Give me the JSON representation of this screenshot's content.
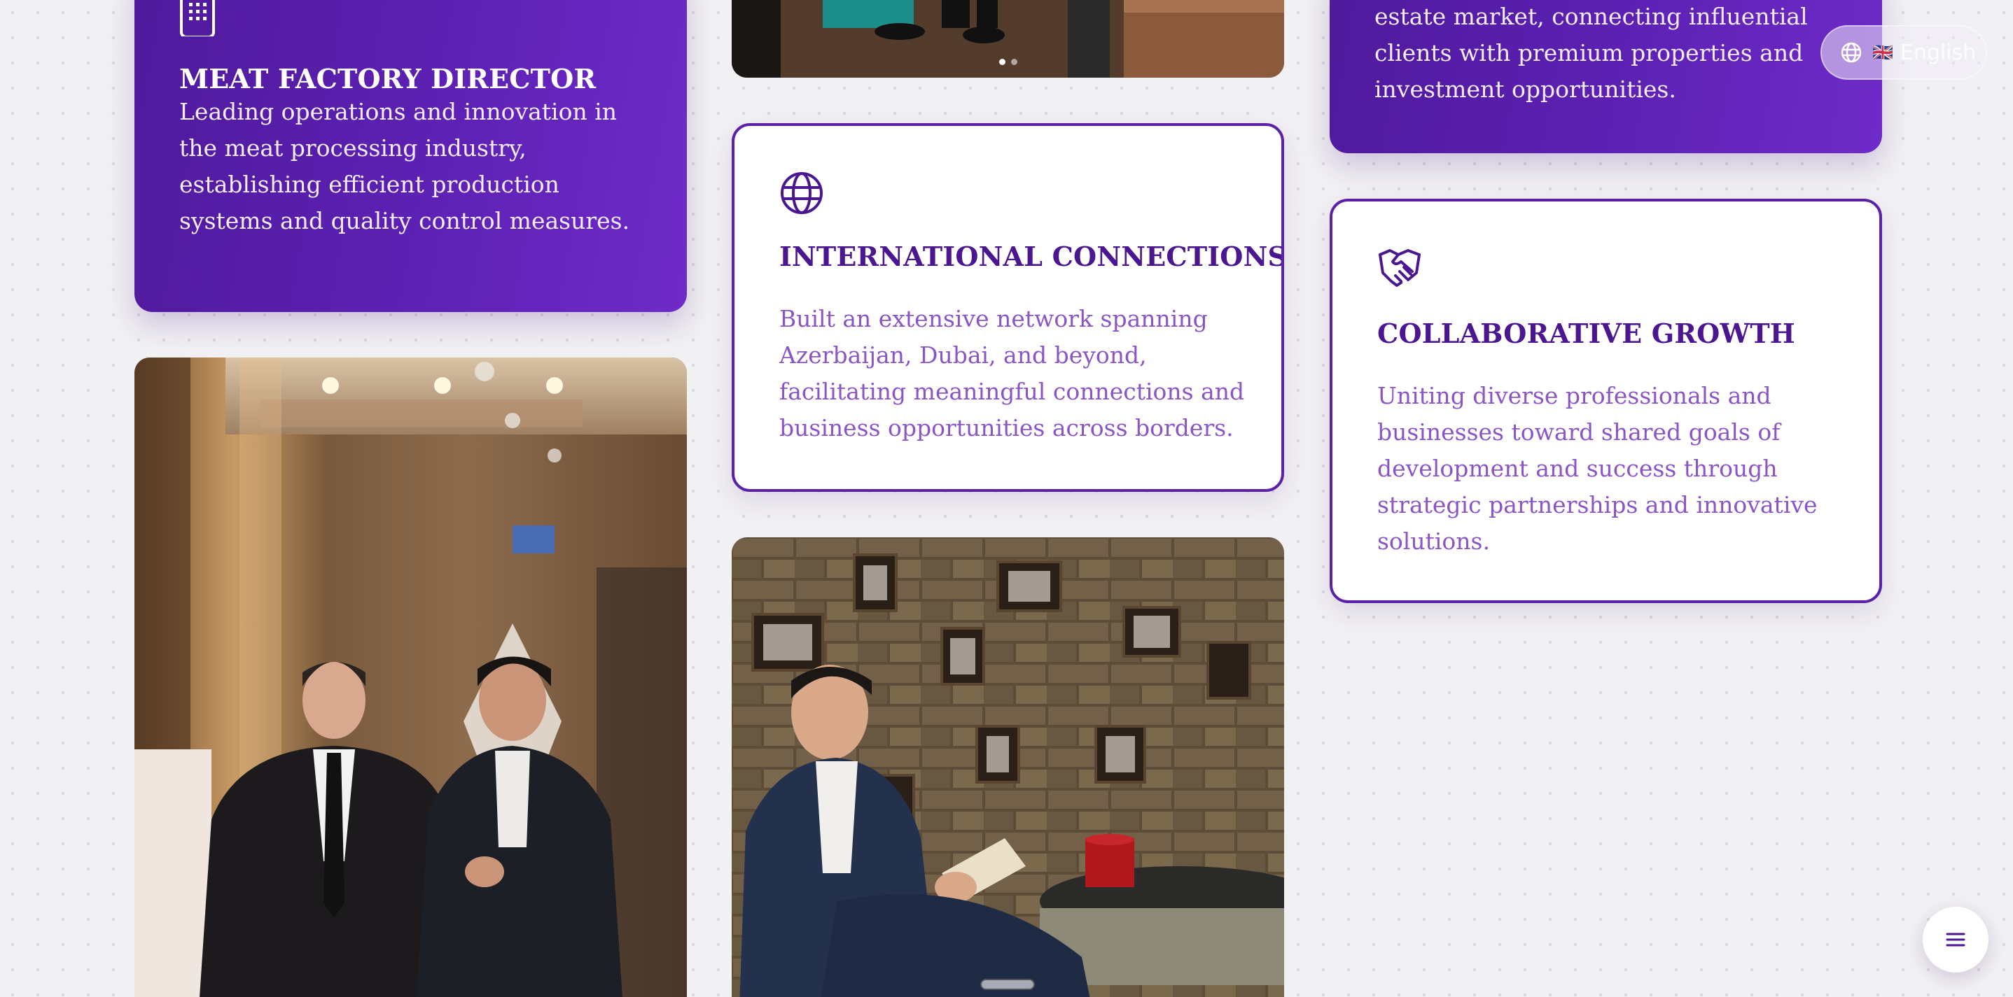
{
  "language": {
    "label": "English",
    "flag": "🇬🇧",
    "icon": "globe-icon"
  },
  "cards": {
    "meat_factory": {
      "icon": "building-icon",
      "title": "MEAT FACTORY DIRECTOR",
      "text": "Leading operations and innovation in the meat processing industry, establishing efficient production systems and quality control measures."
    },
    "real_estate": {
      "text": "estate market, connecting influential clients with premium properties and investment opportunities."
    },
    "international": {
      "icon": "globe-icon",
      "title": "INTERNATIONAL CONNECTIONS",
      "text": "Built an extensive network spanning Azerbaijan, Dubai, and beyond, facilitating meaningful connections and business opportunities across borders."
    },
    "collaborative": {
      "icon": "handshake-icon",
      "title": "COLLABORATIVE GROWTH",
      "text": "Uniting diverse professionals and businesses toward shared goals of development and success through strategic partnerships and innovative solutions."
    }
  },
  "carousel": {
    "dots": 2,
    "active_dot": 1
  },
  "menu": {
    "icon": "menu-icon"
  },
  "colors": {
    "accent": "#5b22a8",
    "card_gradient_start": "#4f1a9c",
    "card_gradient_end": "#6f2bc8",
    "body_text_light": "#8a55c6"
  }
}
